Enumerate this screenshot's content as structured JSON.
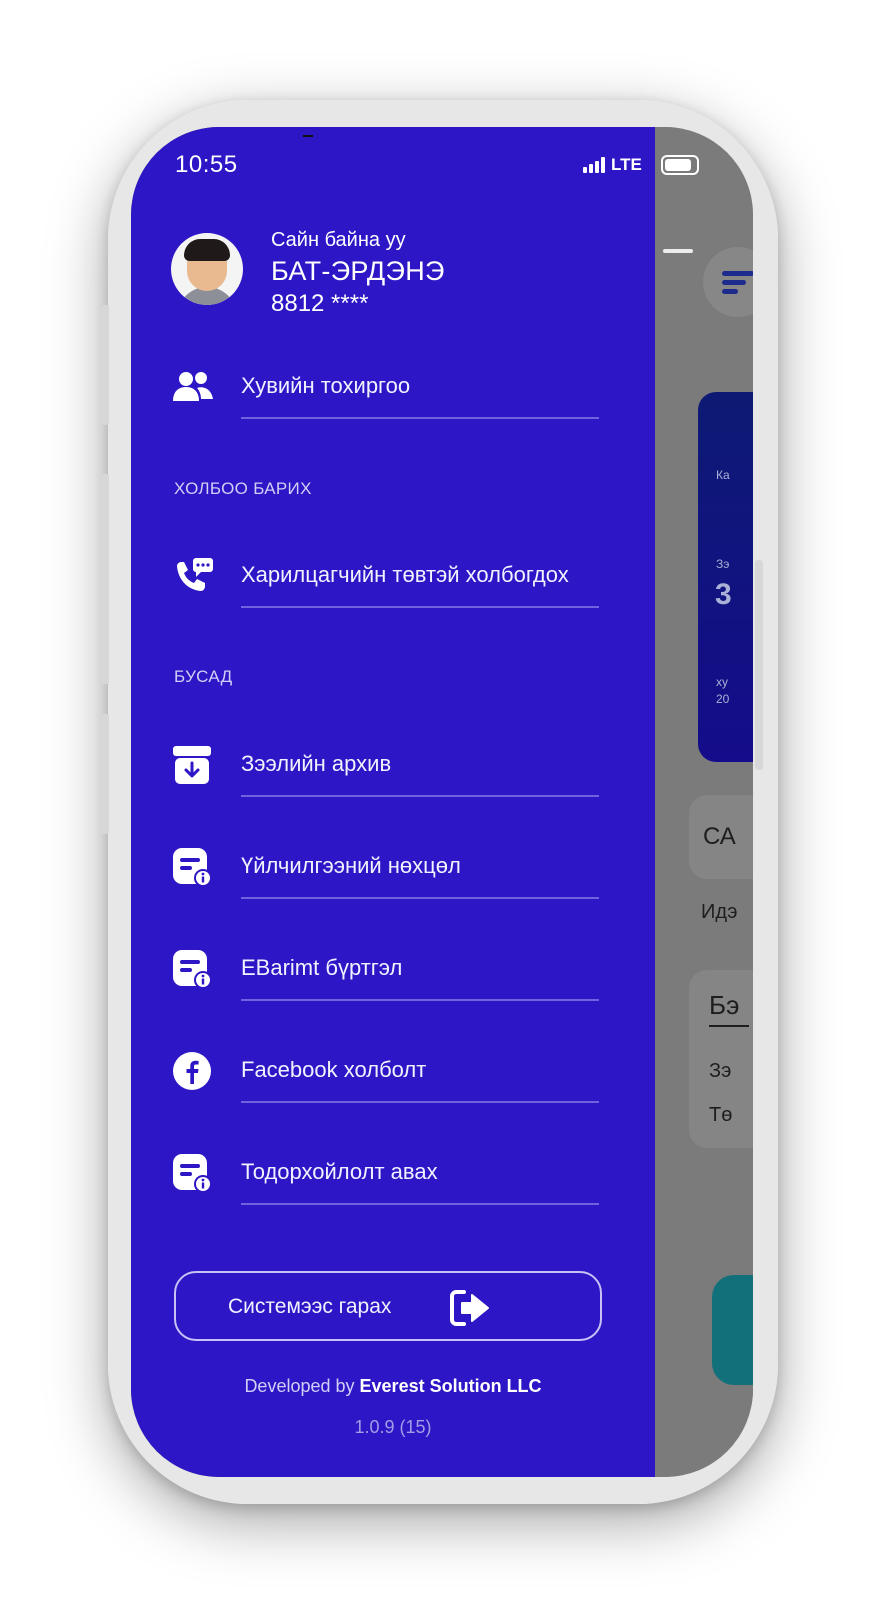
{
  "status_bar": {
    "time": "10:55",
    "network": "LTE"
  },
  "profile": {
    "greeting": "Сайн байна уу",
    "name": "БАТ-ЭРДЭНЭ",
    "phone": "8812 ****"
  },
  "menu": {
    "personal_settings": "Хувийн тохиргоо",
    "contact_section_title": "ХОЛБОО БАРИХ",
    "customer_center": "Харилцагчийн төвтэй холбогдох",
    "other_section_title": "БУСАД",
    "items": [
      {
        "label": "Зээлийн архив",
        "icon": "archive-download-icon"
      },
      {
        "label": "Үйлчилгээний нөхцөл",
        "icon": "info-document-icon"
      },
      {
        "label": "EBarimt бүртгэл",
        "icon": "info-document-icon"
      },
      {
        "label": "Facebook холболт",
        "icon": "facebook-icon"
      },
      {
        "label": "Тодорхойлолт авах",
        "icon": "info-document-icon"
      }
    ]
  },
  "logout": {
    "label": "Системээс гарах",
    "icon": "logout-arrow-icon"
  },
  "footer": {
    "developed_by": "Developed by",
    "company": "Everest Solution LLC",
    "version": "1.0.9  (15)"
  },
  "background_app": {
    "card_label_1": "Ка",
    "card_label_2": "Зэ",
    "card_big": "3",
    "card_label_3": "ху",
    "card_label_4": "20",
    "panel_text": "СА",
    "section_text": "Идэ",
    "panel2_title": "Бэ",
    "panel2_row1": "Зэ",
    "panel2_row2": "Тө"
  },
  "colors": {
    "drawer_bg": "#2c16c6",
    "overlay_bg": "#7b7b7b",
    "phone_frame": "#e7e7e7"
  }
}
